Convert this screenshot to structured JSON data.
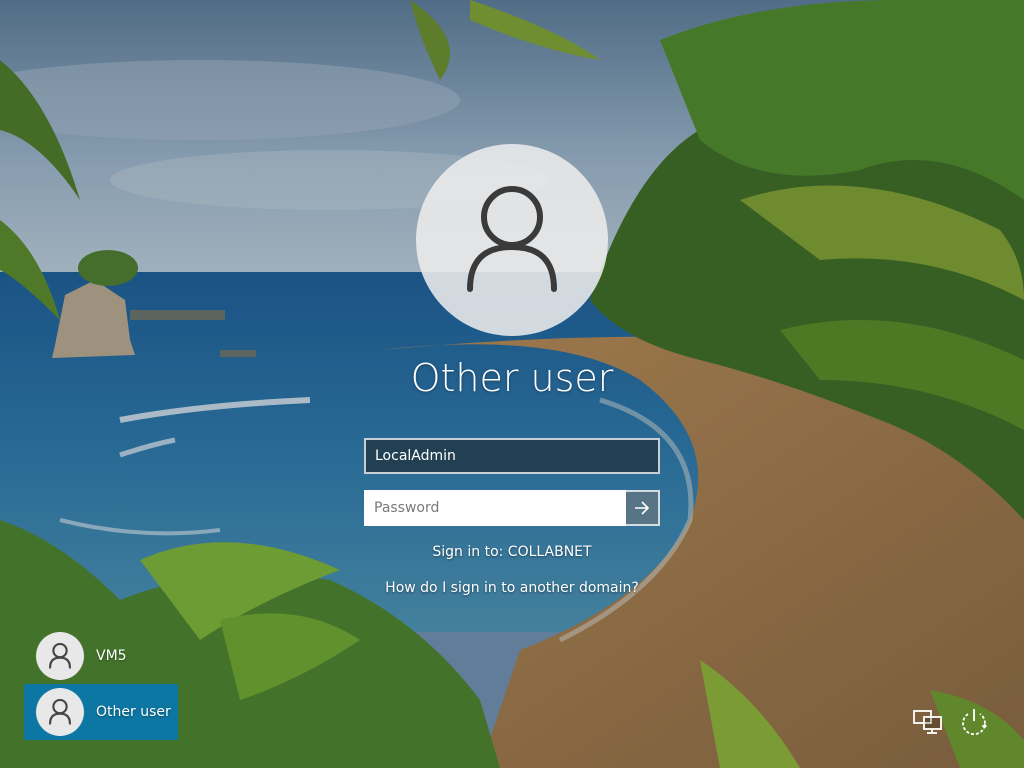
{
  "login": {
    "heading": "Other user",
    "username_value": "LocalAdmin",
    "password_placeholder": "Password",
    "sign_in_to": "Sign in to: COLLABNET",
    "other_domain_link": "How do I sign in to another domain?"
  },
  "user_list": [
    {
      "label": "VM5",
      "selected": false
    },
    {
      "label": "Other user",
      "selected": true
    }
  ],
  "icons": {
    "avatar": "user-silhouette-icon",
    "submit": "arrow-right-icon",
    "network": "network-icon",
    "power": "power-icon"
  },
  "colors": {
    "selected_tile": "#0078be",
    "text": "#ffffff",
    "avatar_circle": "#ececec"
  }
}
